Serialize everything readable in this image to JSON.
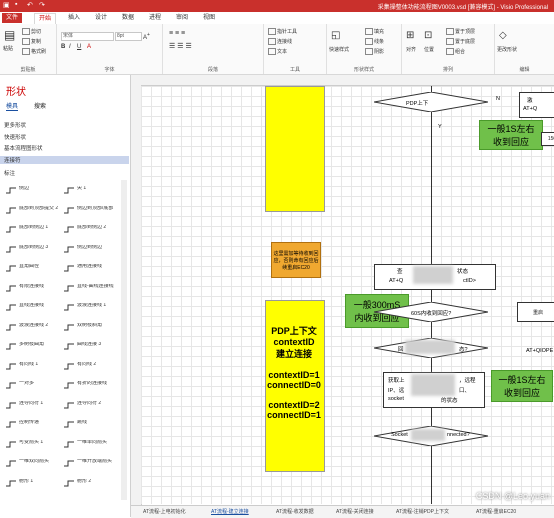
{
  "titlebar": {
    "qa_icons": [
      "visio-icon",
      "save-icon",
      "undo-icon",
      "redo-icon"
    ],
    "doc_title": "采集操整体功能流程图V0003.vsd [兼容模式] - Visio Professional",
    "bg": "#c9302c"
  },
  "tabs": [
    "文件",
    "开始",
    "插入",
    "设计",
    "数据",
    "进程",
    "审阅",
    "视图"
  ],
  "ribbon": {
    "clipboard": {
      "paste": "粘贴",
      "cut": "剪切",
      "copy": "复制",
      "format_painter": "格式刷",
      "label": "剪贴板"
    },
    "font": {
      "name": "宋体",
      "size": "8pt",
      "label": "字体"
    },
    "paragraph": {
      "label": "段落"
    },
    "tools": {
      "pointer": "指针工具",
      "connector": "连接线",
      "text": "文本",
      "label": "工具"
    },
    "shape_style": {
      "quick": "快速样式",
      "fill": "填充",
      "line": "线条",
      "shadow": "阴影",
      "label": "形状样式"
    },
    "arrange": {
      "align": "对齐",
      "position": "位置",
      "bring_front": "置于顶层",
      "send_back": "置于底层",
      "group": "组合",
      "label": "排列"
    },
    "edit": {
      "change_shape": "更改形状",
      "label": "编辑"
    }
  },
  "shapes_pane": {
    "title": "形状",
    "subtabs": [
      "模具",
      "搜索"
    ],
    "menu": [
      "更多形状",
      "快速形状",
      "基本流程图形状",
      "连接符",
      "标注"
    ],
    "selected_menu": 3,
    "items": [
      "侧边",
      "尖 1",
      "底部到顶部提交 2",
      "侧边到顶部/底部",
      "底部到侧边 1",
      "底部到侧边 2",
      "底部到侧边 3",
      "侧边到侧边",
      "直角曲径",
      "通用连接线",
      "有限连接线",
      "直线-曲线连接线",
      "直线连接线",
      "波浪连接线 1",
      "波浪连接线 2",
      "双树枝斜角",
      "多树枝曲角",
      "曲线连接 3",
      "有向线 1",
      "有向线 2",
      "一对多",
      "有折的连接线",
      "连导向符 1",
      "连导向符 2",
      "控制传递",
      "跳线",
      "可变箭头 1",
      "一维单向箭头",
      "一维双向箭头",
      "一维开放端箭头",
      "射形 1",
      "射形 2"
    ]
  },
  "canvas": {
    "yellow_top": "",
    "pdp_note": "PDP上下文\ncontextID\n建立连接\n\ncontextID=1\nconnectID=0\n\ncontextID=2\nconnectID=1",
    "orange_note": "这里需加等待收到回应，否则命有回应后续重启EC20",
    "green_1": "一般1S左右\n收到回应",
    "green_2": "一般300mS\n内收到回应",
    "green_3": "一般1S左右\n收到回应",
    "n_label": "N",
    "y_label": "Y",
    "decision_1": "PDP上下",
    "box_1": "查",
    "box_1b": "AT+Q",
    "box_1c": "ctID>",
    "box_1d": "状态",
    "decision_2": "60S内收到回应?",
    "decision_3": "回",
    "decision_3b": "态?",
    "box_2a": "获取上",
    "box_2b": "IP、远",
    "box_2c": "socket",
    "box_2d": "，远程",
    "box_2e": "口、",
    "box_2f": "的状态",
    "decision_4a": "Socket",
    "decision_4b": "nnected?",
    "right_1": "激",
    "right_1b": "AT+Q",
    "right_2": "150",
    "right_3": "重启",
    "right_4": "AT+QIOPE"
  },
  "page_tabs": [
    "AT流程-上电初始化",
    "AT流程-建立连接",
    "AT流程-收发数据",
    "AT流程-关闭连接",
    "AT流程-注销PDP上下文",
    "AT流程-重启EC20"
  ],
  "active_page_tab": 1,
  "watermark": "CSDN @Leo.yuan",
  "colors": {
    "accent": "#c9302c",
    "yellow": "#ffff00",
    "green": "#70c04a",
    "orange": "#f0a830"
  }
}
